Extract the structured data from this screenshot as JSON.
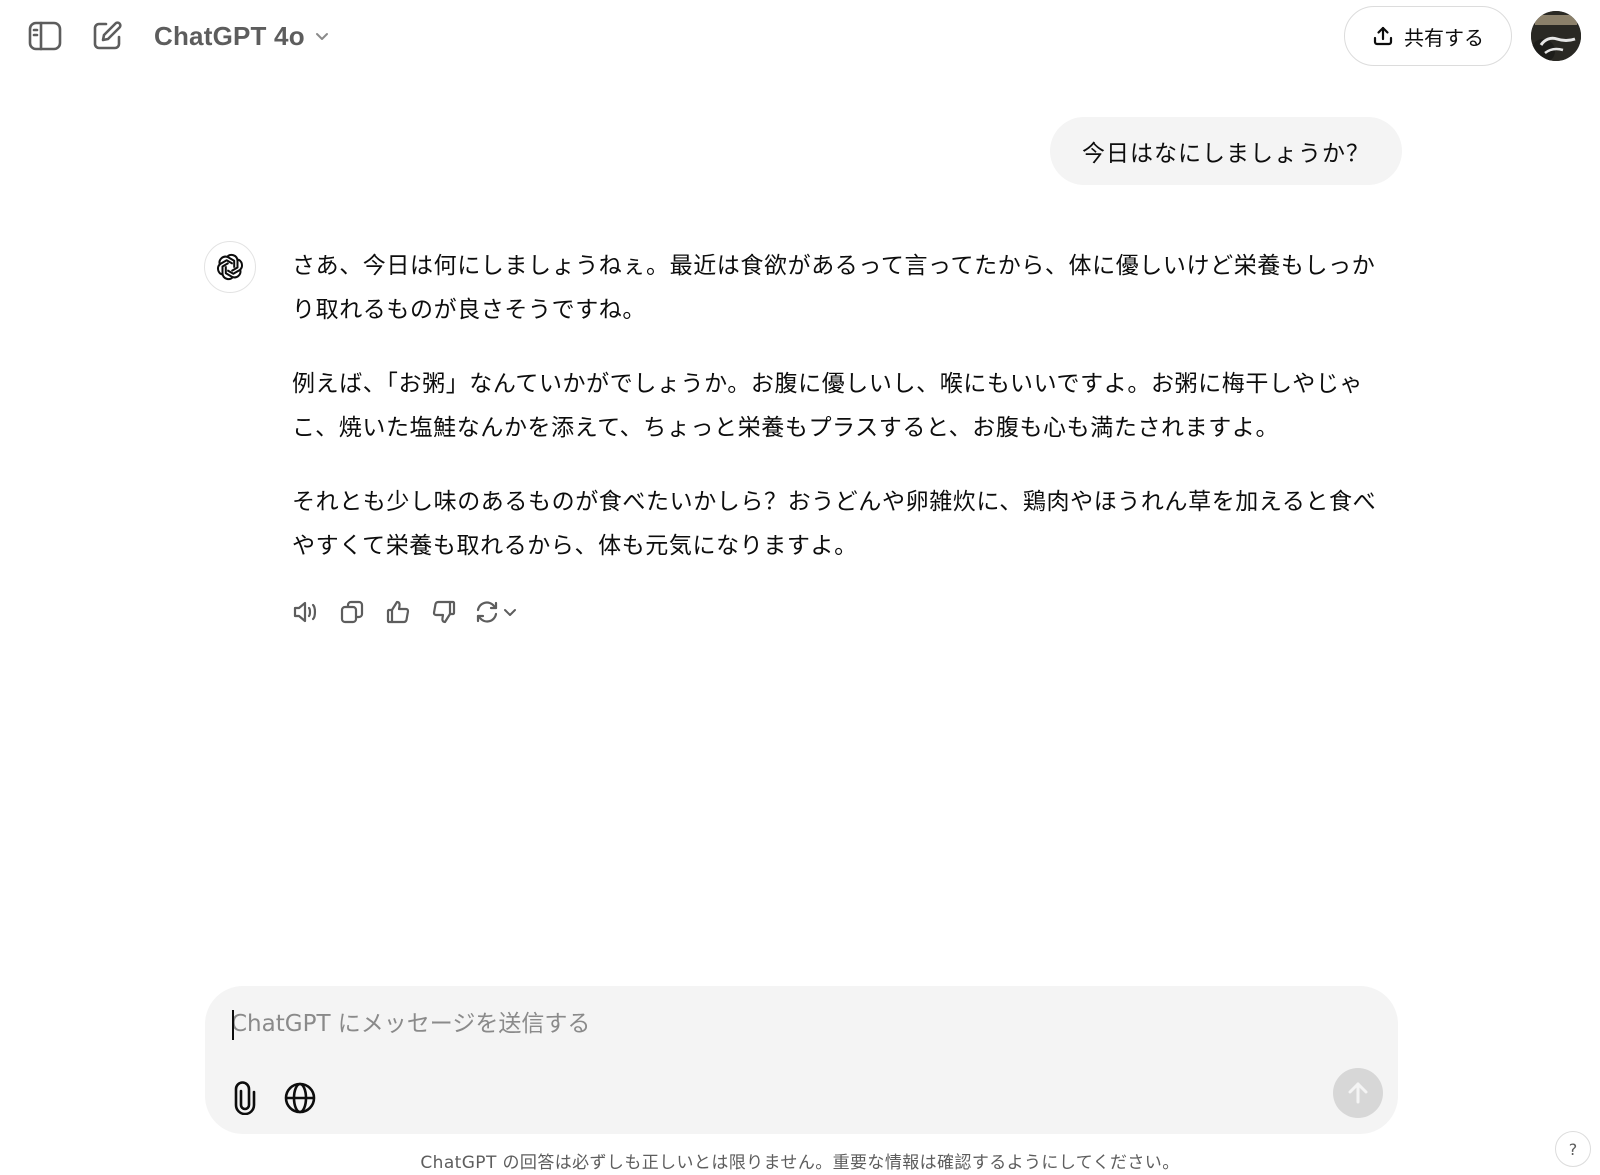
{
  "header": {
    "model_name": "ChatGPT 4o",
    "share_label": "共有する"
  },
  "conversation": {
    "user_message": "今日はなにしましょうか？",
    "assistant_paragraphs": [
      "さあ、今日は何にしましょうねぇ。最近は食欲があるって言ってたから、体に優しいけど栄養もしっかり取れるものが良さそうですね。",
      "例えば、「お粥」なんていかがでしょうか。お腹に優しいし、喉にもいいですよ。お粥に梅干しやじゃこ、焼いた塩鮭なんかを添えて、ちょっと栄養もプラスすると、お腹も心も満たされますよ。",
      "それとも少し味のあるものが食べたいかしら？おうどんや卵雑炊に、鶏肉やほうれん草を加えると食べやすくて栄養も取れるから、体も元気になりますよ。"
    ]
  },
  "composer": {
    "placeholder": "ChatGPT にメッセージを送信する",
    "value": ""
  },
  "footer": {
    "disclaimer": "ChatGPT の回答は必ずしも正しいとは限りません。重要な情報は確認するようにしてください。",
    "help_label": "?"
  },
  "icons": {
    "sidebar": "sidebar-toggle-icon",
    "new_chat": "new-chat-icon",
    "share": "share-upload-icon",
    "read_aloud": "speaker-icon",
    "copy": "copy-icon",
    "like": "thumbs-up-icon",
    "dislike": "thumbs-down-icon",
    "regenerate": "regenerate-icon",
    "attach": "paperclip-icon",
    "web": "globe-icon",
    "send": "arrow-up-icon"
  },
  "colors": {
    "bubble_bg": "#f4f4f4",
    "muted_text": "#5d5d5d",
    "send_disabled": "#d7d7d7"
  }
}
